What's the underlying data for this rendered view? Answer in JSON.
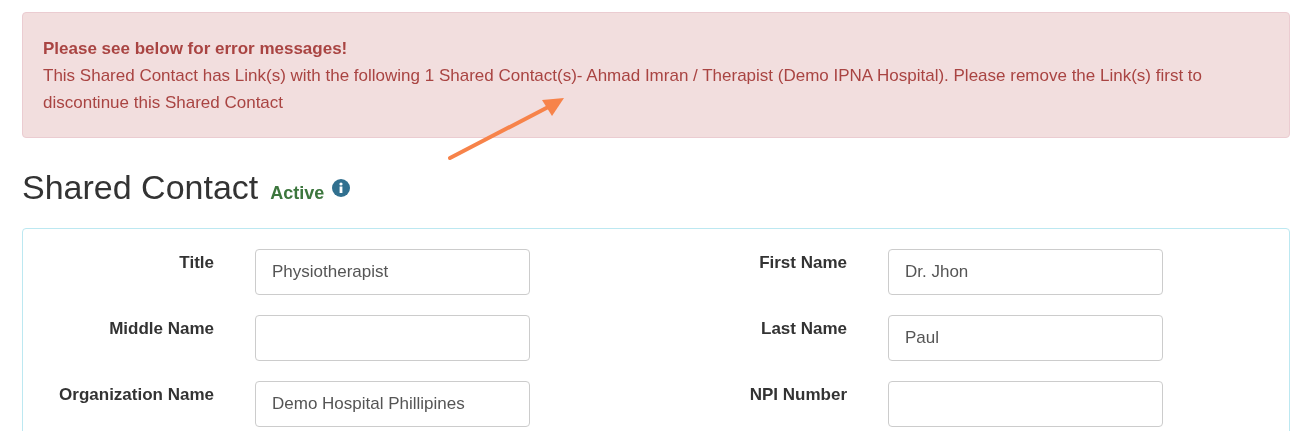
{
  "alert": {
    "title": "Please see below for error messages!",
    "message": "This Shared Contact has Link(s) with the following 1 Shared Contact(s)- Ahmad Imran / Therapist (Demo IPNA Hospital). Please remove the Link(s) first to discontinue this Shared Contact"
  },
  "heading": {
    "title": "Shared Contact",
    "status": "Active"
  },
  "fields": [
    {
      "label": "Title",
      "value": "Physiotherapist"
    },
    {
      "label": "First Name",
      "value": "Dr. Jhon"
    },
    {
      "label": "Middle Name"
    },
    {
      "label": "Last Name",
      "value": "Paul"
    },
    {
      "label": "Organization Name",
      "value": "Demo Hospital Phillipines"
    },
    {
      "label": "NPI Number"
    }
  ]
}
